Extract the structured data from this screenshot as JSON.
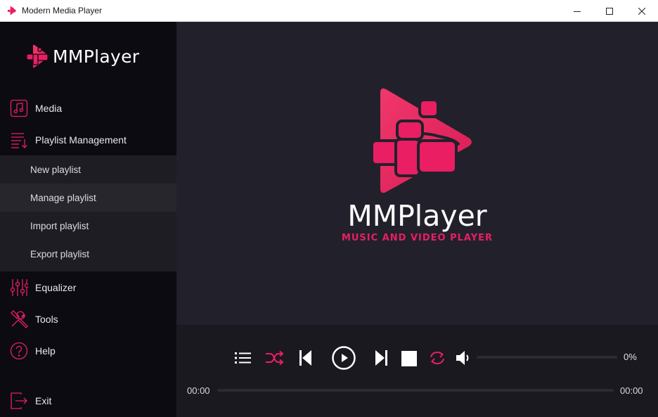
{
  "window": {
    "title": "Modern Media Player",
    "controls": [
      "minimize-icon",
      "maximize-icon",
      "close-icon"
    ]
  },
  "brand": {
    "name": "MMPlayer"
  },
  "sidebar": {
    "items": [
      {
        "label": "Media",
        "icon": "music-note-icon"
      },
      {
        "label": "Playlist Management",
        "icon": "playlist-icon"
      },
      {
        "label": "Equalizer",
        "icon": "equalizer-icon"
      },
      {
        "label": "Tools",
        "icon": "tools-icon"
      },
      {
        "label": "Help",
        "icon": "help-icon"
      }
    ],
    "submenu": [
      {
        "label": "New playlist"
      },
      {
        "label": "Manage playlist",
        "active": true
      },
      {
        "label": "Import playlist"
      },
      {
        "label": "Export playlist"
      }
    ],
    "exit": {
      "label": "Exit",
      "icon": "exit-icon"
    }
  },
  "hero": {
    "title": "MMPlayer",
    "subtitle": "MUSIC AND VIDEO PLAYER"
  },
  "player": {
    "controls": [
      "playlist-icon",
      "shuffle-icon",
      "previous-icon",
      "play-icon",
      "next-icon",
      "stop-icon",
      "repeat-icon",
      "volume-icon"
    ],
    "volume": "0%",
    "volume_level": 0,
    "time_current": "00:00",
    "time_total": "00:00",
    "progress": 0
  },
  "colors": {
    "accent": "#e91e63",
    "sidebar_bg": "#0c0b12",
    "submenu_bg": "#1e1d24",
    "submenu_active_bg": "#27262d",
    "main_bg": "#22212b",
    "player_bg": "#1a1920"
  }
}
